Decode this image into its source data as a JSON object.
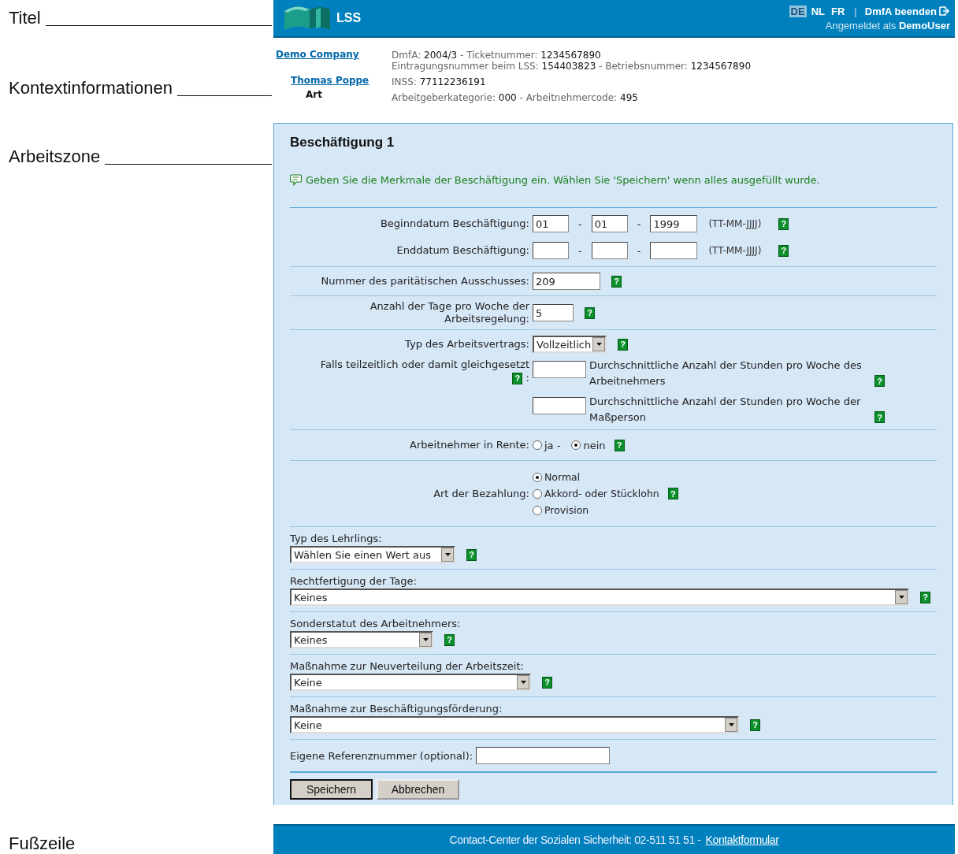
{
  "annotations": [
    {
      "text": "Titel"
    },
    {
      "text": "Kontextinformationen"
    },
    {
      "text": "Arbeitszone"
    },
    {
      "text": "Fußzeile"
    }
  ],
  "header": {
    "logo_text": "LSS",
    "languages": [
      {
        "label": "DE",
        "selected": true
      },
      {
        "label": "NL",
        "selected": false
      },
      {
        "label": "FR",
        "selected": false
      }
    ],
    "separator": "|",
    "exit": "DmfA beenden",
    "login": "Angemeldet als **DemoUser**"
  },
  "context": {
    "company": "Demo Company",
    "person": "Thomas Poppe",
    "type": "Art",
    "lines": [
      [
        {
          "kind": "label",
          "text": "DmfA:"
        },
        {
          "kind": "value",
          "text": "2004/3"
        },
        {
          "kind": "label",
          "text": "- Ticketnummer:"
        },
        {
          "kind": "value",
          "text": "1234567890"
        }
      ],
      [
        {
          "kind": "label",
          "text": "Eintragungsnummer beim LSS:"
        },
        {
          "kind": "value",
          "text": "154403823"
        },
        {
          "kind": "label",
          "text": "- Betriebsnummer:"
        },
        {
          "kind": "value",
          "text": "1234567890"
        }
      ],
      [
        {
          "kind": "label",
          "text": "INSS:"
        },
        {
          "kind": "value",
          "text": "77112236191"
        }
      ],
      [
        {
          "kind": "label",
          "text": "Arbeitgeberkategorie:"
        },
        {
          "kind": "value",
          "text": "000"
        },
        {
          "kind": "label",
          "text": "- Arbeitnehmercode:"
        },
        {
          "kind": "value",
          "text": "495"
        }
      ]
    ]
  },
  "form": {
    "title": "Beschäftigung 1",
    "hint": "Geben Sie die Merkmale der Beschäftigung ein. Wählen Sie 'Speichern' wenn alles ausgefüllt wurde.",
    "groups": [
      [
        {
          "kind": "date",
          "label": "Beginndatum Beschäftigung:",
          "parts": [
            "01",
            "01",
            "1999"
          ],
          "separators": [
            "-",
            "-"
          ],
          "format": "(TT-MM-JJJJ)",
          "help": "?"
        },
        {
          "kind": "date",
          "label": "Enddatum Beschäftigung:",
          "separators": [
            "-",
            "-"
          ],
          "format": "(TT-MM-JJJJ)",
          "help": "?"
        }
      ],
      [
        {
          "kind": "text",
          "label": "Nummer des paritätischen Ausschusses:",
          "value": "209",
          "help": "?"
        }
      ],
      [
        {
          "kind": "text",
          "label": "Anzahl der Tage pro Woche der Arbeitsregelung:",
          "value": "5",
          "help": "?"
        }
      ],
      [
        {
          "kind": "select",
          "label": "Typ des Arbeitsvertrags:",
          "value": "Vollzeitlich",
          "help": "?"
        },
        {
          "kind": "parttime",
          "label": "Falls teilzeitlich oder damit gleichgesetzt",
          "help": "?",
          "colon": ":",
          "fields": [
            {
              "caption": "Durchschnittliche Anzahl der Stunden pro Woche des Arbeitnehmers",
              "help": "?"
            },
            {
              "caption": "Durchschnittliche Anzahl der Stunden pro Woche der Maßperson",
              "help": "?"
            }
          ]
        }
      ],
      [
        {
          "kind": "radio",
          "label": "Arbeitnehmer in Rente:",
          "options": [
            {
              "label": "ja -",
              "selected": false
            },
            {
              "label": "nein",
              "selected": true,
              "help": "?"
            }
          ]
        }
      ],
      [
        {
          "kind": "radio-stack",
          "label": "Art der Bezahlung:",
          "options": [
            {
              "label": "Normal",
              "selected": true
            },
            {
              "label": "Akkord- oder Stücklohn",
              "selected": false,
              "help": "?"
            },
            {
              "label": "Provision",
              "selected": false
            }
          ]
        }
      ],
      [
        {
          "kind": "select-block",
          "label": "Typ des Lehrlings:",
          "value": "Wählen Sie einen Wert aus",
          "help": "?"
        }
      ],
      [
        {
          "kind": "select-block",
          "label": "Rechtfertigung der Tage:",
          "value": "Keines",
          "help": "?"
        }
      ],
      [
        {
          "kind": "select-block",
          "label": "Sonderstatut des Arbeitnehmers:",
          "value": "Keines",
          "help": "?"
        }
      ],
      [
        {
          "kind": "select-block",
          "label": "Maßnahme zur Neuverteilung der Arbeitszeit:",
          "value": "Keine",
          "help": "?"
        }
      ],
      [
        {
          "kind": "select-block",
          "label": "Maßnahme zur Beschäftigungsförderung:",
          "value": "Keine",
          "help": "?"
        }
      ],
      [
        {
          "kind": "text-inline",
          "label": "Eigene Referenznummer (optional):"
        }
      ]
    ],
    "buttons": [
      "Speichern",
      "Abbrechen"
    ]
  },
  "footer": {
    "text": "Contact-Center der Sozialen Sicherheit: 02-511 51 51 -",
    "link": "Kontaktformular"
  }
}
